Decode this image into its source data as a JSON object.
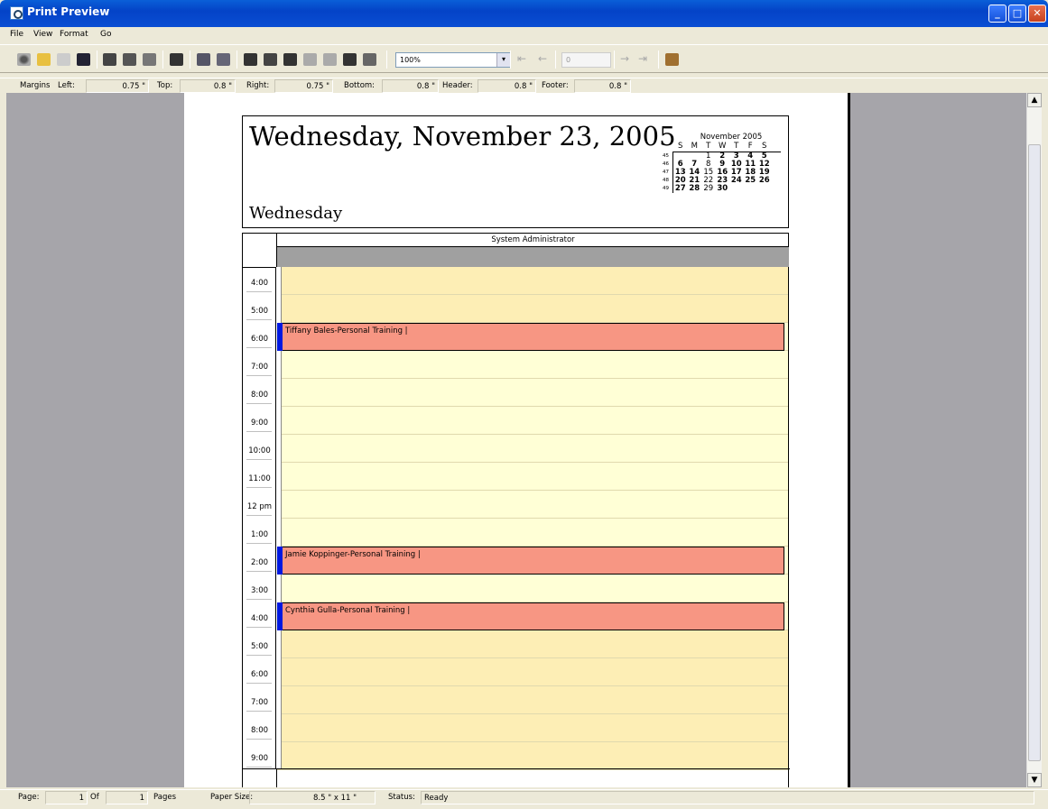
{
  "window": {
    "title": "Print Preview"
  },
  "menu": [
    "File",
    "View",
    "Format",
    "Go"
  ],
  "toolbar": {
    "zoom": "100%",
    "page_input": "0"
  },
  "margins": {
    "label": "Margins",
    "left_label": "Left:",
    "left": "0.75 \"",
    "top_label": "Top:",
    "top": "0.8 \"",
    "right_label": "Right:",
    "right": "0.75 \"",
    "bottom_label": "Bottom:",
    "bottom": "0.8 \"",
    "header_label": "Header:",
    "header": "0.8 \"",
    "footer_label": "Footer:",
    "footer": "0.8 \""
  },
  "page": {
    "title": "Wednesday, November 23, 2005",
    "subtitle": "Wednesday",
    "minical": {
      "month": "November 2005",
      "days": [
        "S",
        "M",
        "T",
        "W",
        "T",
        "F",
        "S"
      ],
      "weeks": [
        {
          "num": "45",
          "cells": [
            "",
            "",
            "1",
            "2",
            "3",
            "4",
            "5"
          ],
          "bold": [
            0,
            0,
            0,
            1,
            1,
            1,
            1
          ]
        },
        {
          "num": "46",
          "cells": [
            "",
            "6",
            "7",
            "8",
            "9",
            "10",
            "11",
            "12"
          ],
          "bold": [
            0,
            1,
            1,
            0,
            1,
            1,
            1,
            1
          ]
        },
        {
          "num": "47",
          "cells": [
            "13",
            "14",
            "15",
            "16",
            "17",
            "18",
            "19"
          ],
          "bold": [
            1,
            1,
            0,
            1,
            1,
            1,
            1
          ]
        },
        {
          "num": "48",
          "cells": [
            "20",
            "21",
            "22",
            "23",
            "24",
            "25",
            "26"
          ],
          "bold": [
            1,
            1,
            0,
            1,
            1,
            1,
            1
          ]
        },
        {
          "num": "49",
          "cells": [
            "27",
            "28",
            "29",
            "30",
            "",
            "",
            ""
          ],
          "bold": [
            1,
            1,
            0,
            1,
            0,
            0,
            0
          ]
        }
      ]
    },
    "resource": "System Administrator",
    "times": [
      "4:00",
      "5:00",
      "6:00",
      "7:00",
      "8:00",
      "9:00",
      "10:00",
      "11:00",
      "12 pm",
      "1:00",
      "2:00",
      "3:00",
      "4:00",
      "5:00",
      "6:00",
      "7:00",
      "8:00",
      "9:00"
    ],
    "appointments": [
      {
        "text": "Tiffany Bales-Personal Training  |",
        "slot": 2
      },
      {
        "text": "Jamie Koppinger-Personal Training  |",
        "slot": 10
      },
      {
        "text": "Cynthia Gulla-Personal Training  |",
        "slot": 12
      }
    ]
  },
  "status": {
    "page_label": "Page:",
    "page": "1",
    "of_label": "Of",
    "pages": "1",
    "pages_label": "Pages",
    "paper_label": "Paper Size:",
    "paper": "8.5 \" x 11 \"",
    "status_label": "Status:",
    "status": "Ready"
  }
}
